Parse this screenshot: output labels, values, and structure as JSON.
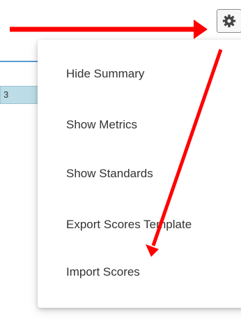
{
  "background": {
    "cell_text": "3"
  },
  "toolbar": {
    "settings_icon": "gear-icon"
  },
  "menu": {
    "items": [
      {
        "label": "Hide Summary"
      },
      {
        "label": "Show Metrics"
      },
      {
        "label": "Show Standards"
      },
      {
        "label": "Export Scores Template"
      },
      {
        "label": "Import Scores"
      }
    ]
  },
  "annotations": {
    "arrow_color": "#ff0000"
  }
}
